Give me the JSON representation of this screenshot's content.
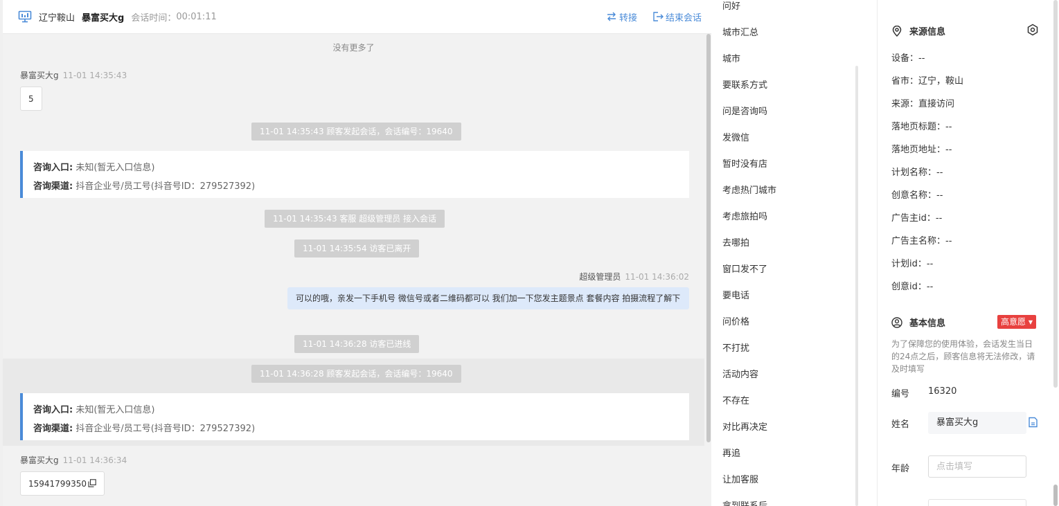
{
  "header": {
    "location": "辽宁鞍山",
    "customer_name": "暴富买大g",
    "session_time_label": "会话时间：",
    "session_time": "00:01:11",
    "transfer_label": "转接",
    "end_label": "结束会话"
  },
  "chat": {
    "no_more": "没有更多了",
    "msg1": {
      "sender": "暴富买大g",
      "time": "11-01 14:35:43",
      "text": "5"
    },
    "sys1": "11-01 14:35:43 顾客发起会话，会话编号：19640",
    "card1": {
      "entry_label": "咨询入口:",
      "entry_value": "未知(暂无入口信息)",
      "channel_label": "咨询渠道:",
      "channel_value": "抖音企业号/员工号(抖音号ID：279527392)"
    },
    "sys2": "11-01 14:35:43 客服 超级管理员 接入会话",
    "sys3": "11-01 14:35:54 访客已离开",
    "agent_msg": {
      "sender": "超级管理员",
      "time": "11-01 14:36:02",
      "text": "可以的哦，亲发一下手机号 微信号或者二维码都可以 我们加一下您发主题景点 套餐内容 拍摄流程了解下"
    },
    "sys4": "11-01 14:36:28 访客已进线",
    "sys5": "11-01 14:36:28 顾客发起会话，会话编号：19640",
    "card2": {
      "entry_label": "咨询入口:",
      "entry_value": "未知(暂无入口信息)",
      "channel_label": "咨询渠道:",
      "channel_value": "抖音企业号/员工号(抖音号ID：279527392)"
    },
    "msg2": {
      "sender": "暴富买大g",
      "time": "11-01 14:36:34",
      "text": "15941799350"
    }
  },
  "quick_replies": [
    "问好",
    "城市汇总",
    "城市",
    "要联系方式",
    "问是咨询吗",
    "发微信",
    "暂时没有店",
    "考虑热门城市",
    "考虑旅拍吗",
    "去哪拍",
    "窗口发不了",
    "要电话",
    "问价格",
    "不打扰",
    "活动内容",
    "不存在",
    "对比再决定",
    "再追",
    "让加客服",
    "拿到联系后"
  ],
  "source_info": {
    "title": "来源信息",
    "fields": [
      {
        "label": "设备：",
        "value": "--"
      },
      {
        "label": "省市：",
        "value": "辽宁，鞍山"
      },
      {
        "label": "来源：",
        "value": "直接访问"
      },
      {
        "label": "落地页标题：",
        "value": "--"
      },
      {
        "label": "落地页地址：",
        "value": "--"
      },
      {
        "label": "计划名称：",
        "value": "--"
      },
      {
        "label": "创意名称：",
        "value": "--"
      },
      {
        "label": "广告主id：",
        "value": "--"
      },
      {
        "label": "广告主名称：",
        "value": "--"
      },
      {
        "label": "计划id：",
        "value": "--"
      },
      {
        "label": "创意id：",
        "value": "--"
      }
    ]
  },
  "basic_info": {
    "title": "基本信息",
    "intent_badge": "高意愿",
    "notice": "为了保障您的使用体验，会话发生当日的24点之后，顾客信息将无法修改，请及时填写",
    "id_label": "编号",
    "id_value": "16320",
    "name_label": "姓名",
    "name_value": "暴富买大g",
    "age_label": "年龄",
    "age_placeholder": "点击填写"
  },
  "colors": {
    "accent": "#4a8bd8",
    "badge": "#e8413f",
    "agent_bubble": "#dde9fa",
    "system_pill": "#d0d0d0"
  }
}
